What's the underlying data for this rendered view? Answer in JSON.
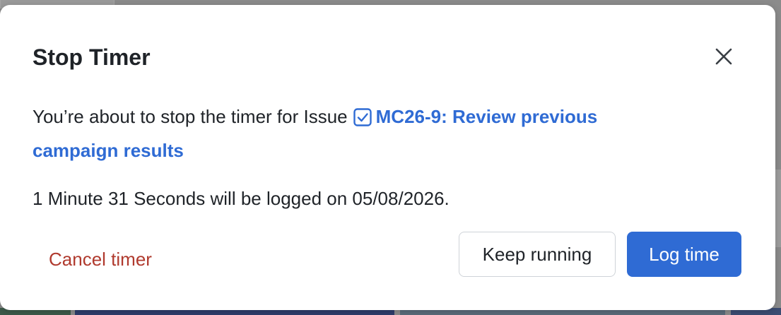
{
  "dialog": {
    "title": "Stop Timer",
    "message_prefix": "You’re about to stop the timer for Issue",
    "issue_link": "MC26-9: Review previous campaign results",
    "log_message": "1 Minute 31 Seconds will be logged on 05/08/2026.",
    "close_icon": "close-icon",
    "issue_icon": "checkbox-icon"
  },
  "actions": {
    "cancel_label": "Cancel timer",
    "keep_running_label": "Keep running",
    "log_time_label": "Log time"
  },
  "colors": {
    "primary": "#2f6bd4",
    "danger": "#b03a2e",
    "text": "#1f2328"
  }
}
